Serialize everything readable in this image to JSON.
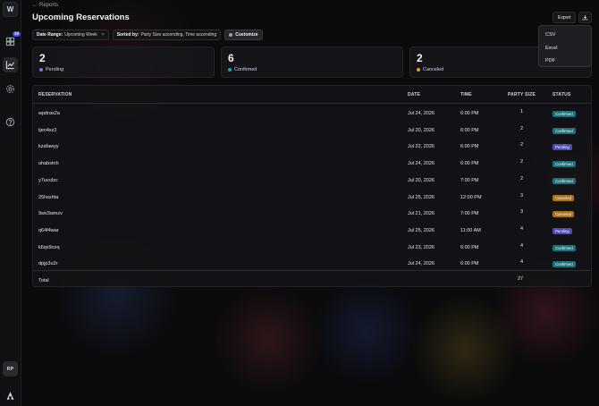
{
  "colors": {
    "confirmed": "#1e6f78",
    "pending": "#4b4bb5",
    "canceled": "#a6731a",
    "pending_dot": "#6b7bd6",
    "confirmed_dot": "#22a2b3",
    "canceled_dot": "#d4a13a"
  },
  "sidebar": {
    "logo": "W",
    "badge": "10",
    "avatar": "RP",
    "icons": [
      "grid-icon",
      "chart-icon",
      "gear-icon",
      "help-icon",
      "logo-icon"
    ]
  },
  "header": {
    "back_label": "Reports",
    "title": "Upcoming Reservations",
    "export_label": "Export"
  },
  "filters": {
    "date_range_key": "Date Range:",
    "date_range_value": "Upcoming Week",
    "date_range_remove": "×",
    "sorted_key": "Sorted by:",
    "sorted_value": "Party Size ascending, Time ascending",
    "customize": "Customize"
  },
  "stats": [
    {
      "value": "2",
      "label": "Pending"
    },
    {
      "value": "6",
      "label": "Confirmed"
    },
    {
      "value": "2",
      "label": "Canceled"
    }
  ],
  "export_menu": [
    "CSV",
    "Excel",
    "PDF"
  ],
  "table": {
    "columns": [
      "RESERVATION",
      "DATE",
      "TIME",
      "PARTY SIZE",
      "STATUS"
    ],
    "rows": [
      {
        "id": "wpdras2a",
        "date": "Jul 24, 2026",
        "time": "6:00 PM",
        "party": "1",
        "status": "Confirmed"
      },
      {
        "id": "tjen4xz2",
        "date": "Jul 20, 2026",
        "time": "6:00 PM",
        "party": "2",
        "status": "Confirmed"
      },
      {
        "id": "kzafawyy",
        "date": "Jul 22, 2026",
        "time": "6:00 PM",
        "party": "2",
        "status": "Pending"
      },
      {
        "id": "uhabstnh",
        "date": "Jul 24, 2026",
        "time": "6:00 PM",
        "party": "2",
        "status": "Confirmed"
      },
      {
        "id": "y7uvufzc",
        "date": "Jul 20, 2026",
        "time": "7:00 PM",
        "party": "2",
        "status": "Confirmed"
      },
      {
        "id": "25hsshta",
        "date": "Jul 25, 2026",
        "time": "12:00 PM",
        "party": "3",
        "status": "Canceled"
      },
      {
        "id": "9wv3wmzv",
        "date": "Jul 21, 2026",
        "time": "7:00 PM",
        "party": "3",
        "status": "Canceled"
      },
      {
        "id": "q64f4war",
        "date": "Jul 25, 2026",
        "time": "11:00 AM",
        "party": "4",
        "status": "Pending"
      },
      {
        "id": "k6qx9ceq",
        "date": "Jul 23, 2026",
        "time": "6:00 PM",
        "party": "4",
        "status": "Confirmed"
      },
      {
        "id": "dpjp3u3r",
        "date": "Jul 24, 2026",
        "time": "6:00 PM",
        "party": "4",
        "status": "Confirmed"
      }
    ],
    "footer_label": "Total",
    "footer_total": "27"
  }
}
